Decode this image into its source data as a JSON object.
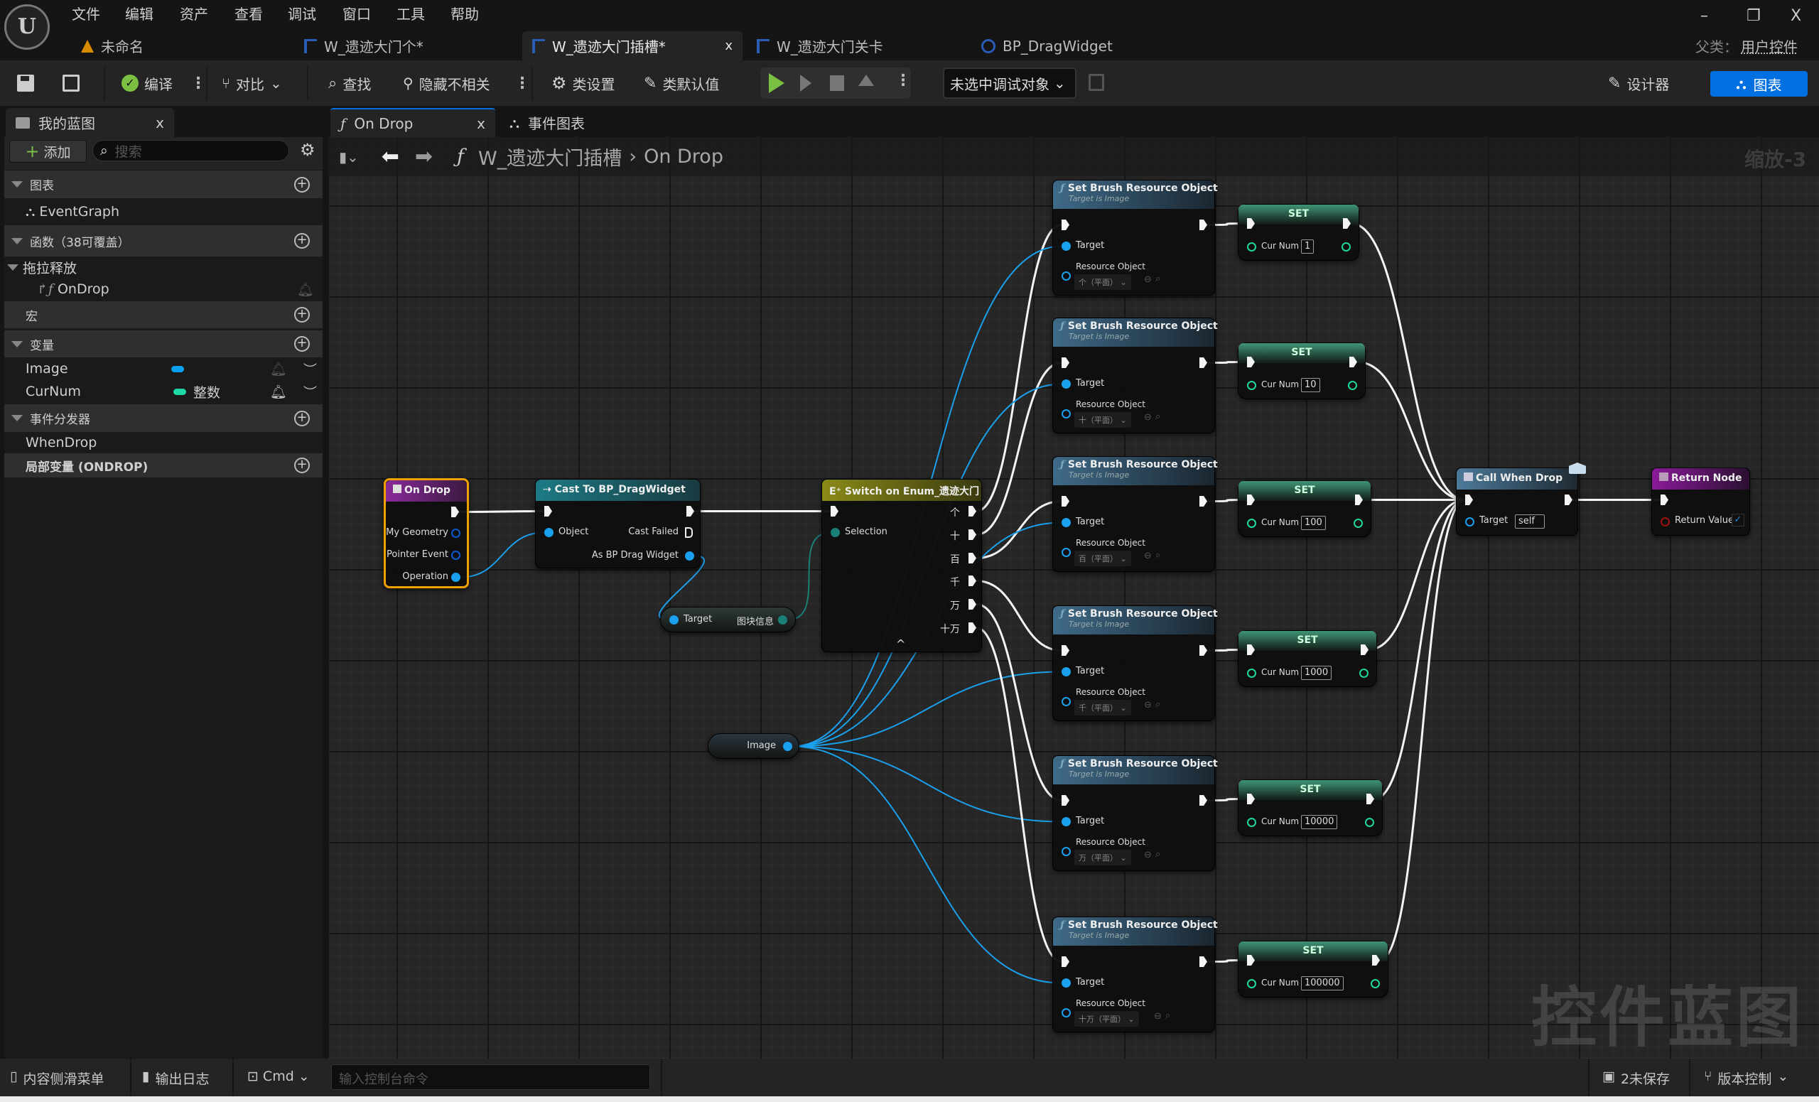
{
  "menu": [
    "文件",
    "编辑",
    "资产",
    "查看",
    "调试",
    "窗口",
    "工具",
    "帮助"
  ],
  "logo_text": "U",
  "doc_tabs": [
    {
      "label": "未命名",
      "icon": "level-icon"
    },
    {
      "label": "W_遗迹大门个*",
      "icon": "widget-blueprint-icon"
    },
    {
      "label": "W_遗迹大门插槽*",
      "icon": "widget-blueprint-icon",
      "active": true,
      "close": "x"
    },
    {
      "label": "W_遗迹大门关卡",
      "icon": "widget-blueprint-icon"
    },
    {
      "label": "BP_DragWidget",
      "icon": "blueprint-class-icon"
    }
  ],
  "parent_class": {
    "label": "父类：",
    "value": "用户控件"
  },
  "window_controls": {
    "minimize": "–",
    "restore": "❐",
    "close": "X"
  },
  "toolbar": {
    "compile": "编译",
    "diff": "对比",
    "find": "查找",
    "hide_unrelated": "隐藏不相关",
    "class_settings": "类设置",
    "class_defaults": "类默认值",
    "debug_object": "未选中调试对象",
    "designer": "设计器",
    "graph": "图表"
  },
  "panel_tabs": {
    "my_blueprint": "我的蓝图",
    "on_drop": "On Drop",
    "event_graph": "事件图表",
    "close": "x"
  },
  "my_blueprint": {
    "add": "添加",
    "search_placeholder": "搜索",
    "graphs_header": "图表",
    "event_graph": "EventGraph",
    "functions_header": "函数（38可覆盖）",
    "category": "拖拉释放",
    "function_item": "OnDrop",
    "macros_header": "宏",
    "variables_header": "变量",
    "variables": [
      {
        "name": "Image",
        "type": "",
        "color": "#0aa0f0"
      },
      {
        "name": "CurNum",
        "type": "整数",
        "color": "#1ed8a6"
      }
    ],
    "dispatchers_header": "事件分发器",
    "dispatcher": "WhenDrop",
    "locals_header": "局部变量 (ONDROP)"
  },
  "breadcrumb": {
    "root": "W_遗迹大门插槽",
    "separator": "›",
    "current": "On Drop"
  },
  "zoom_label": "缩放-3",
  "watermark": "控件蓝图",
  "graph": {
    "on_drop": {
      "title": "On Drop",
      "pins": [
        "My Geometry",
        "Pointer Event",
        "Operation"
      ]
    },
    "cast": {
      "title": "Cast To BP_DragWidget",
      "object": "Object",
      "cast_failed": "Cast Failed",
      "as_widget": "As BP Drag Widget"
    },
    "getter": {
      "target": "Target",
      "output": "图块信息"
    },
    "switch": {
      "title": "Switch on Enum_遗迹大门",
      "selection": "Selection",
      "caret": "^"
    },
    "image_getter": {
      "label": "Image"
    },
    "sbro": {
      "title": "Set Brush Resource Object",
      "subtitle": "Target is Image",
      "target": "Target",
      "resource": "Resource Object"
    },
    "set": {
      "title": "SET",
      "var": "Cur Num"
    },
    "branches": [
      {
        "case": "个",
        "resource": "个（平面）",
        "value": "1"
      },
      {
        "case": "十",
        "resource": "十（平面）",
        "value": "10"
      },
      {
        "case": "百",
        "resource": "百（平面）",
        "value": "100"
      },
      {
        "case": "千",
        "resource": "千（平面）",
        "value": "1000"
      },
      {
        "case": "万",
        "resource": "万（平面）",
        "value": "10000"
      },
      {
        "case": "十万",
        "resource": "十万（平面）",
        "value": "100000"
      }
    ],
    "call": {
      "title": "Call When Drop",
      "target": "Target",
      "target_value": "self"
    },
    "return": {
      "title": "Return Node",
      "label": "Return Value",
      "checked": true
    }
  },
  "status_bar": {
    "content_drawer": "内容侧滑菜单",
    "output_log": "输出日志",
    "cmd": "Cmd",
    "console_placeholder": "输入控制台命令",
    "unsaved": "2未保存",
    "source_control": "版本控制"
  },
  "colors": {
    "exec": "#f4f4f4",
    "object": "#1aa0ec",
    "enum": "#1a7f77",
    "int": "#1fd7a0",
    "accent": "#0070e0"
  }
}
